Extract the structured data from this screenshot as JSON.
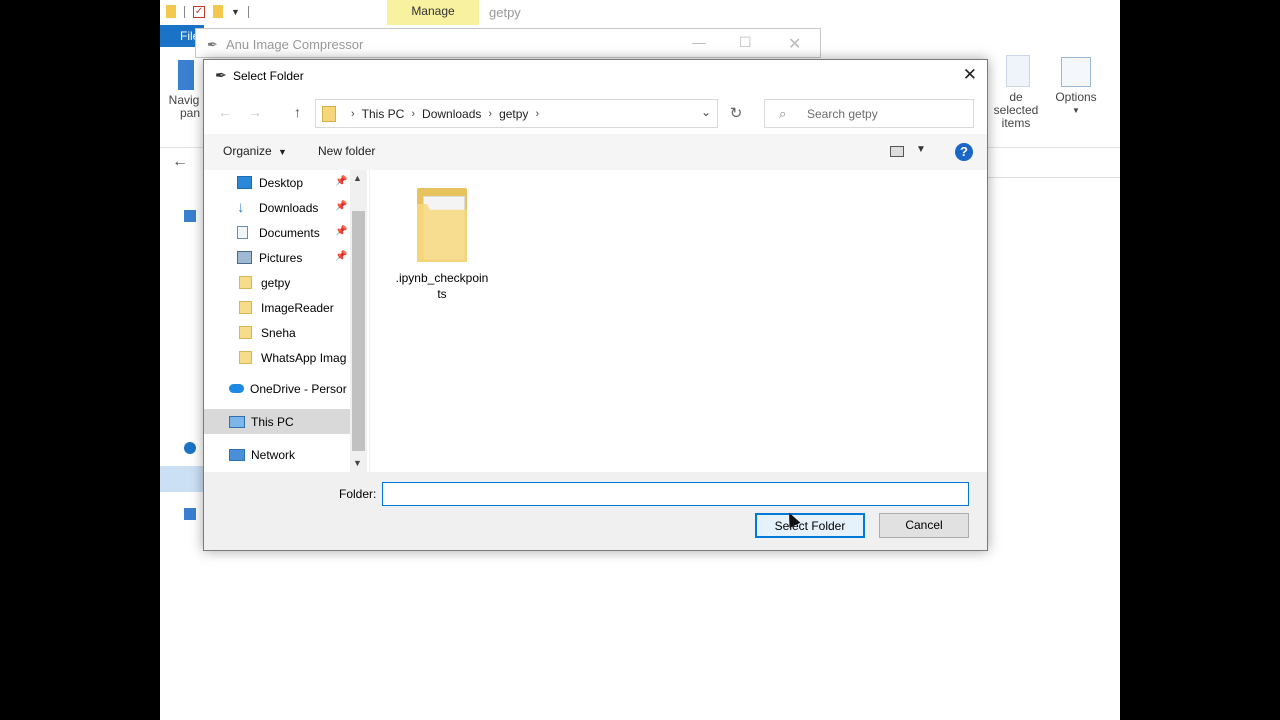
{
  "background": {
    "ribbon_tab_manage": "Manage",
    "window_title": "getpy",
    "file_tab": "File",
    "ribbon_nav_pane_line1": "Navig",
    "ribbon_nav_pane_line2": "pan",
    "ribbon_hide_selected_line1": "de selected",
    "ribbon_hide_selected_line2": "items",
    "ribbon_options": "Options"
  },
  "app_window": {
    "title": "Anu Image Compressor"
  },
  "dialog": {
    "title": "Select Folder",
    "breadcrumb": [
      "This PC",
      "Downloads",
      "getpy"
    ],
    "search_placeholder": "Search getpy",
    "toolbar": {
      "organize": "Organize",
      "new_folder": "New folder"
    },
    "nav_items": [
      {
        "label": "Desktop",
        "icon": "desktop-icon",
        "pinned": true
      },
      {
        "label": "Downloads",
        "icon": "download-icon",
        "pinned": true
      },
      {
        "label": "Documents",
        "icon": "documents-icon",
        "pinned": true
      },
      {
        "label": "Pictures",
        "icon": "pictures-icon",
        "pinned": true
      },
      {
        "label": "getpy",
        "icon": "folder-icon",
        "pinned": false
      },
      {
        "label": "ImageReader",
        "icon": "folder-icon",
        "pinned": false
      },
      {
        "label": "Sneha",
        "icon": "folder-icon",
        "pinned": false
      },
      {
        "label": "WhatsApp Imag",
        "icon": "folder-icon",
        "pinned": false
      },
      {
        "label": "OneDrive - Persor",
        "icon": "onedrive-icon",
        "pinned": false
      },
      {
        "label": "This PC",
        "icon": "computer-icon",
        "pinned": false,
        "selected": true
      },
      {
        "label": "Network",
        "icon": "network-icon",
        "pinned": false
      }
    ],
    "files": [
      {
        "name": ".ipynb_checkpoints",
        "icon": "folder-icon"
      }
    ],
    "folder_label": "Folder:",
    "folder_value": "",
    "select_button": "Select Folder",
    "cancel_button": "Cancel",
    "colors": {
      "accent": "#0078d7",
      "help": "#1a66c9",
      "folder": "#f5d67a"
    }
  }
}
